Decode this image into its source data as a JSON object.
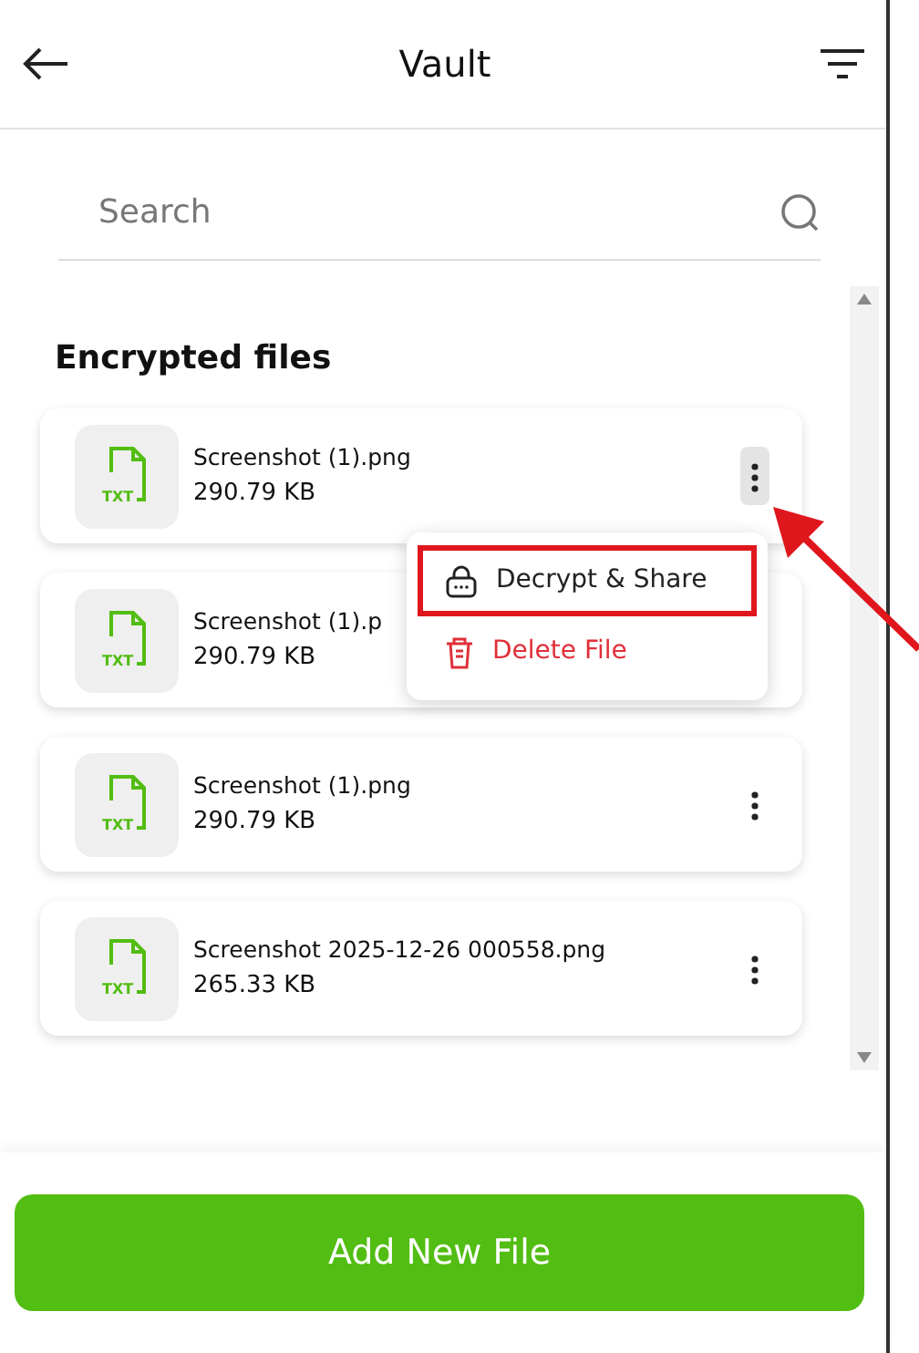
{
  "header": {
    "title": "Vault"
  },
  "search": {
    "placeholder": "Search"
  },
  "section_title": "Encrypted files",
  "files": [
    {
      "icon_label": "TXT",
      "name": "Screenshot (1).png",
      "size": "290.79 KB",
      "menu_open": true
    },
    {
      "icon_label": "TXT",
      "name": "Screenshot (1).p",
      "size": "290.79 KB",
      "menu_open": false
    },
    {
      "icon_label": "TXT",
      "name": "Screenshot (1).png",
      "size": "290.79 KB",
      "menu_open": false
    },
    {
      "icon_label": "TXT",
      "name": "Screenshot 2025-12-26 000558.png",
      "size": "265.33 KB",
      "menu_open": false
    }
  ],
  "menu": {
    "items": [
      {
        "kind": "decrypt",
        "label": "Decrypt & Share",
        "annotated": true
      },
      {
        "kind": "delete",
        "label": "Delete File",
        "annotated": false
      }
    ]
  },
  "add_button": "Add New File"
}
